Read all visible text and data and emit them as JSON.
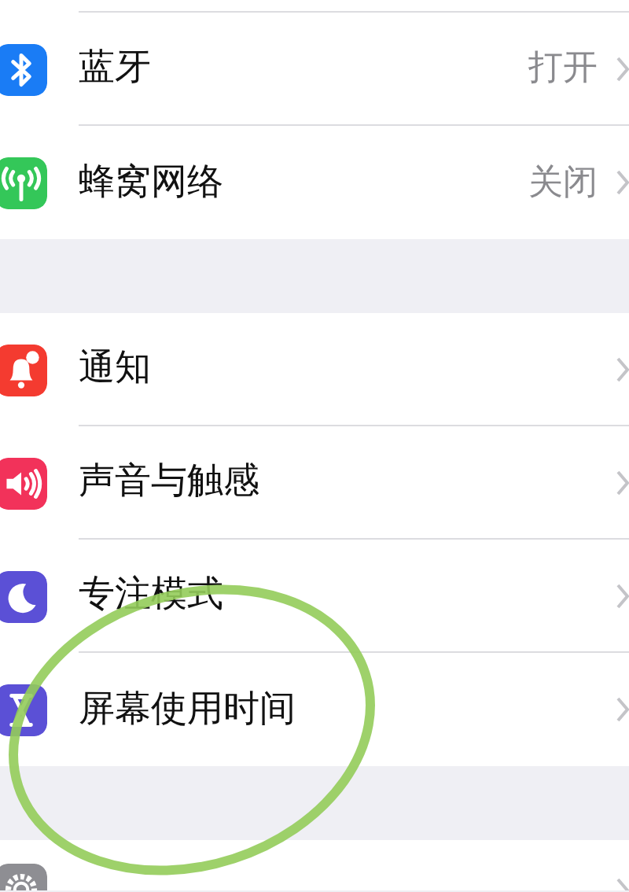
{
  "groups": [
    {
      "items": [
        {
          "label": "蓝牙",
          "value": "打开",
          "kind": "bluetooth",
          "color": "#1a7cf5"
        },
        {
          "label": "蜂窝网络",
          "value": "关闭",
          "kind": "antenna",
          "color": "#34c759"
        }
      ]
    },
    {
      "items": [
        {
          "label": "通知",
          "kind": "bell",
          "color": "#f43b30"
        },
        {
          "label": "声音与触感",
          "kind": "speaker",
          "color": "#f2325a"
        },
        {
          "label": "专注模式",
          "kind": "moon",
          "color": "#5b50d6"
        },
        {
          "label": "屏幕使用时间",
          "kind": "hourglass",
          "color": "#5b50d6"
        }
      ]
    },
    {
      "items": [
        {
          "kind": "gear",
          "color": "#8e8e93"
        }
      ]
    }
  ]
}
